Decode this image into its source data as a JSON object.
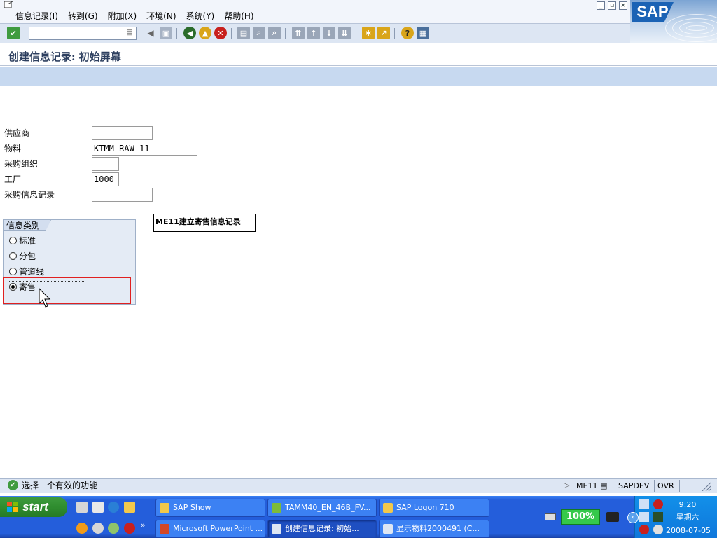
{
  "window": {
    "menu": [
      "信息记录(I)",
      "转到(G)",
      "附加(X)",
      "环境(N)",
      "系统(Y)",
      "帮助(H)"
    ],
    "logo_text": "SAP"
  },
  "toolbar": {
    "command_value": "",
    "icons": [
      "enter-icon",
      "back-icon",
      "exit-icon",
      "cancel-icon",
      "print-icon",
      "find-icon",
      "find-next-icon",
      "first-page-icon",
      "prev-page-icon",
      "next-page-icon",
      "last-page-icon",
      "new-session-icon",
      "shortcut-icon",
      "help-icon",
      "layout-icon"
    ]
  },
  "screen": {
    "title": "创建信息记录: 初始屏幕"
  },
  "form": {
    "vendor_label": "供应商",
    "vendor_value": "",
    "material_label": "物料",
    "material_value": "KTMM_RAW_11",
    "purch_org_label": "采购组织",
    "purch_org_value": "",
    "plant_label": "工厂",
    "plant_value": "1000",
    "info_record_label": "采购信息记录",
    "info_record_value": ""
  },
  "info_category": {
    "title": "信息类别",
    "options": [
      {
        "label": "标准",
        "selected": false
      },
      {
        "label": "分包",
        "selected": false
      },
      {
        "label": "管道线",
        "selected": false
      },
      {
        "label": "寄售",
        "selected": true
      }
    ]
  },
  "annotation": {
    "text": "ME11建立寄售信息记录"
  },
  "status": {
    "message": "选择一个有效的功能",
    "transaction": "ME11",
    "system": "SAPDEV",
    "mode": "OVR"
  },
  "taskbar": {
    "start_label": "start",
    "tasks_row1": [
      "SAP Show",
      "TAMM40_EN_46B_FV...",
      "SAP Logon 710"
    ],
    "tasks_row2": [
      "Microsoft PowerPoint ...",
      "创建信息记录: 初始...",
      "显示物料2000491 (C..."
    ],
    "battery": "100%",
    "time": "9:20",
    "weekday": "星期六",
    "date": "2008-07-05"
  },
  "colors": {
    "sap_blue": "#1b63b5",
    "app_bar": "#c7d9f0",
    "highlight_red": "#e02020",
    "taskbar_blue": "#245edb",
    "start_green": "#2f8d2f"
  }
}
